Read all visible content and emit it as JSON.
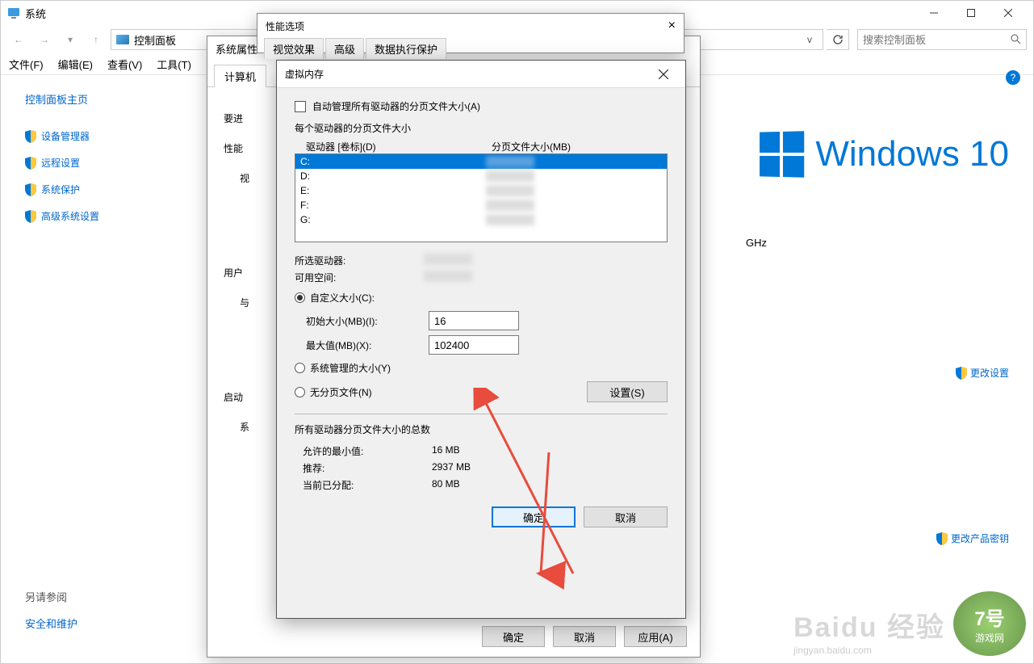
{
  "main": {
    "title": "系统",
    "breadcrumb": "控制面板",
    "search_placeholder": "搜索控制面板",
    "menus": [
      "文件(F)",
      "编辑(E)",
      "查看(V)",
      "工具(T)"
    ],
    "cp_home": "控制面板主页",
    "sidebar_links": [
      "设备管理器",
      "远程设置",
      "系统保护",
      "高级系统设置"
    ],
    "see_also_hdr": "另请参阅",
    "see_also_link": "安全和维护",
    "win10_text": "Windows 10",
    "ghz": "GHz",
    "change_settings": "更改设置",
    "change_key": "更改产品密钥",
    "help": "?"
  },
  "sysprops": {
    "title": "系统属性",
    "tabs": [
      "计算机"
    ],
    "body_lines": [
      "要进",
      "性能",
      "视",
      "用户",
      "与",
      "启动",
      "系"
    ],
    "ok": "确定",
    "cancel": "取消",
    "apply": "应用(A)"
  },
  "perfopts": {
    "title": "性能选项",
    "tabs": [
      "视觉效果",
      "高级",
      "数据执行保护"
    ]
  },
  "vmem": {
    "title": "虚拟内存",
    "auto_manage": "自动管理所有驱动器的分页文件大小(A)",
    "per_drive_hdr": "每个驱动器的分页文件大小",
    "col_drive": "驱动器 [卷标](D)",
    "col_pf": "分页文件大小(MB)",
    "drives": [
      "C:",
      "D:",
      "E:",
      "F:",
      "G:"
    ],
    "selected_drive_lbl": "所选驱动器:",
    "free_space_lbl": "可用空间:",
    "custom_size": "自定义大小(C):",
    "init_lbl": "初始大小(MB)(I):",
    "init_val": "16",
    "max_lbl": "最大值(MB)(X):",
    "max_val": "102400",
    "sys_managed": "系统管理的大小(Y)",
    "no_paging": "无分页文件(N)",
    "set_btn": "设置(S)",
    "totals_hdr": "所有驱动器分页文件大小的总数",
    "min_lbl": "允许的最小值:",
    "min_val": "16 MB",
    "rec_lbl": "推荐:",
    "rec_val": "2937 MB",
    "cur_lbl": "当前已分配:",
    "cur_val": "80 MB",
    "ok": "确定",
    "cancel": "取消"
  },
  "watermark": {
    "baidu": "Baidu 经验",
    "sub": "jingyan.baidu.com",
    "badge_num": "7号",
    "badge_txt": "游戏网"
  }
}
